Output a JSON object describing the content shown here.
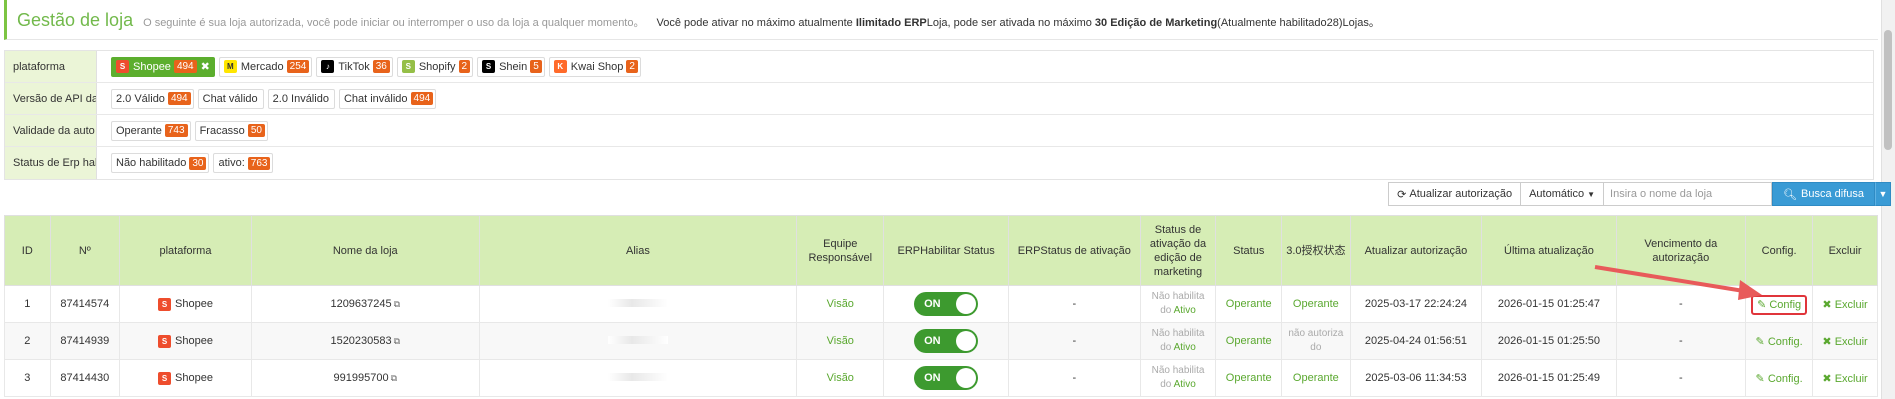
{
  "header": {
    "title": "Gestão de loja",
    "subtitle": "O seguinte é sua loja autorizada, você pode iniciar ou interromper o uso da loja a qualquer momento。",
    "notice_pre": "Você pode ativar no máximo atualmente ",
    "notice_b1": "Ilimitado ERP",
    "notice_mid": "Loja, pode ser ativada no máximo ",
    "notice_b2": "30 Edição de Marketing",
    "notice_post": "(Atualmente habilitado28)Lojas。"
  },
  "filters": {
    "platform": {
      "label": "plataforma",
      "items": [
        {
          "label": "Shopee",
          "count": "494",
          "active": true
        },
        {
          "label": "Mercado",
          "count": "254"
        },
        {
          "label": "TikTok",
          "count": "36"
        },
        {
          "label": "Shopify",
          "count": "2"
        },
        {
          "label": "Shein",
          "count": "5"
        },
        {
          "label": "Kwai Shop",
          "count": "2"
        }
      ]
    },
    "api": {
      "label": "Versão de API da",
      "items": [
        {
          "label": "2.0 Válido",
          "count": "494"
        },
        {
          "label": "Chat válido",
          "count": ""
        },
        {
          "label": "2.0 Inválido",
          "count": ""
        },
        {
          "label": "Chat inválido",
          "count": "494"
        }
      ]
    },
    "auth": {
      "label": "Validade da auto",
      "items": [
        {
          "label": "Operante",
          "count": "743"
        },
        {
          "label": "Fracasso",
          "count": "50"
        }
      ]
    },
    "erp": {
      "label": "Status de Erp hab",
      "items": [
        {
          "label": "Não habilitado",
          "count": "30"
        },
        {
          "label": "ativo:",
          "count": "763"
        }
      ]
    }
  },
  "toolbar": {
    "refresh": "Atualizar autorização",
    "auto": "Automático",
    "search_placeholder": "Insira o nome da loja",
    "search_btn": "Busca difusa"
  },
  "table": {
    "headers": [
      "ID",
      "Nº",
      "plataforma",
      "Nome da loja",
      "Alias",
      "Equipe Responsável",
      "ERPHabilitar Status",
      "ERPStatus de ativação",
      "Status de ativação da edição de marketing",
      "Status",
      "3.0授权状态",
      "Atualizar autorização",
      "Última atualização",
      "Vencimento da autorização",
      "Config.",
      "Excluir"
    ],
    "rows": [
      {
        "id": "1",
        "num": "87414574",
        "platform": "Shopee",
        "name": "1209637245",
        "team": "Visão",
        "toggle": "ON",
        "erp_status": "-",
        "mkt1": "Não habilita",
        "mkt2": "do",
        "mkt3": "Ativo",
        "status": "Operante",
        "auth30": "Operante",
        "auth30_ok": true,
        "updated_auth": "2025-03-17 22:24:24",
        "last_update": "2026-01-15 01:25:47",
        "expiry": "-",
        "config": "Config",
        "delete": "Excluir"
      },
      {
        "id": "2",
        "num": "87414939",
        "platform": "Shopee",
        "name": "1520230583",
        "team": "Visão",
        "toggle": "ON",
        "erp_status": "-",
        "mkt1": "Não habilita",
        "mkt2": "do",
        "mkt3": "Ativo",
        "status": "Operante",
        "auth30": "não autoriza do",
        "auth30_ok": false,
        "updated_auth": "2025-04-24 01:56:51",
        "last_update": "2026-01-15 01:25:50",
        "expiry": "-",
        "config": "Config.",
        "delete": "Excluir"
      },
      {
        "id": "3",
        "num": "87414430",
        "platform": "Shopee",
        "name": "991995700",
        "team": "Visão",
        "toggle": "ON",
        "erp_status": "-",
        "mkt1": "Não habilita",
        "mkt2": "do",
        "mkt3": "Ativo",
        "status": "Operante",
        "auth30": "Operante",
        "auth30_ok": true,
        "updated_auth": "2025-03-06 11:34:53",
        "last_update": "2026-01-15 01:25:49",
        "expiry": "-",
        "config": "Config.",
        "delete": "Excluir"
      }
    ]
  },
  "colors": {
    "accent": "#5cae2e",
    "badge": "#e8631b",
    "header_bg": "#d6edb5",
    "highlight": "#e0353b"
  }
}
